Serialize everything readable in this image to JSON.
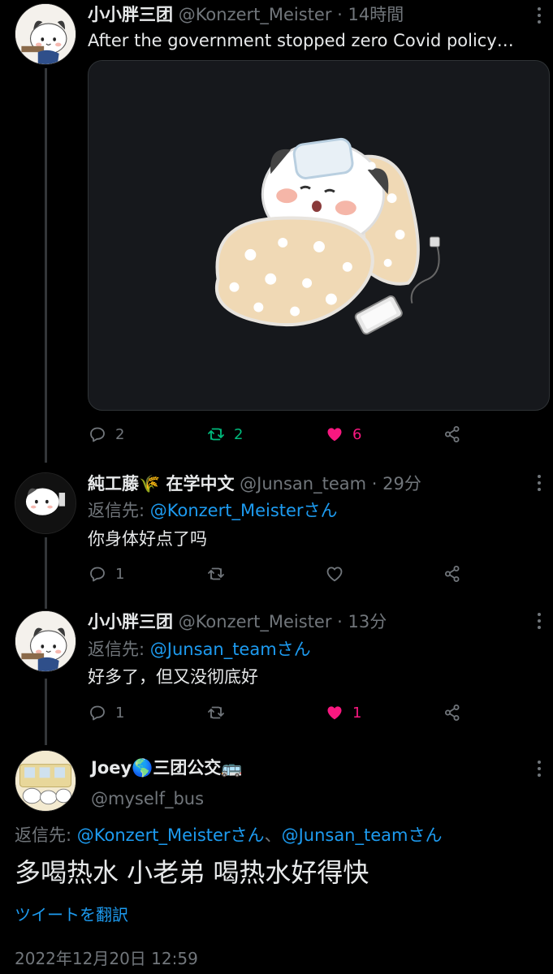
{
  "tweet1": {
    "display_name": "小小胖三团",
    "handle": "@Konzert_Meister",
    "time": "14時間",
    "text": "After the government stopped zero Covid policy…",
    "stats": {
      "replies": "2",
      "retweets": "2",
      "likes": "6"
    }
  },
  "reply1": {
    "display_name": "純工藤🌾 在学中文",
    "handle": "@Junsan_team",
    "time": "29分",
    "reply_label": "返信先:",
    "reply_to": "@Konzert_Meisterさん",
    "text": "你身体好点了吗",
    "stats": {
      "replies": "1"
    }
  },
  "reply2": {
    "display_name": "小小胖三团",
    "handle": "@Konzert_Meister",
    "time": "13分",
    "reply_label": "返信先:",
    "reply_to": "@Junsan_teamさん",
    "text": "好多了，但又没彻底好",
    "stats": {
      "replies": "1",
      "likes": "1"
    }
  },
  "main_tweet": {
    "display_name": "Joey🌎三团公交🚌",
    "handle": "@myself_bus",
    "reply_label": "返信先:",
    "reply_to_1": "@Konzert_Meisterさん",
    "reply_sep": "、",
    "reply_to_2": "@Junsan_teamさん",
    "text": "多喝热水 小老弟 喝热水好得快",
    "translate_label": "ツイートを翻訳",
    "timestamp": "2022年12月20日 12:59"
  },
  "colors": {
    "background": "#000000",
    "text_primary": "#e7e9ea",
    "text_secondary": "#71767b",
    "link": "#1d9bf0",
    "retweet": "#00ba7c",
    "like": "#f91880"
  },
  "icons": [
    "more-icon",
    "reply-icon",
    "retweet-icon",
    "like-icon",
    "share-icon"
  ]
}
